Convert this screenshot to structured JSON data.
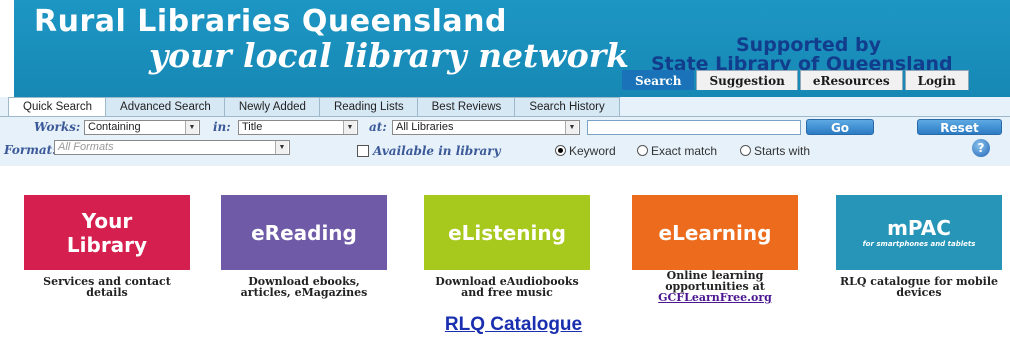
{
  "header": {
    "title_line1": "Rural Libraries Queensland",
    "title_line2": "your local library network",
    "supported_line1": "Supported by",
    "supported_line2": "State Library of Queensland",
    "tabs": [
      "Search",
      "Suggestion",
      "eResources",
      "Login"
    ],
    "active_tab": "Search"
  },
  "search": {
    "tabs": [
      "Quick Search",
      "Advanced Search",
      "Newly Added",
      "Reading Lists",
      "Best Reviews",
      "Search History"
    ],
    "active_tab": "Quick Search",
    "works_label": "Works:",
    "works_value": "Containing",
    "in_label": "in:",
    "in_value": "Title",
    "at_label": "at:",
    "at_value": "All Libraries",
    "query_value": "",
    "go_label": "Go",
    "reset_label": "Reset",
    "format_label": "Format:",
    "format_placeholder": "All Formats",
    "available_label": "Available in library",
    "available_checked": false,
    "match_options": [
      "Keyword",
      "Exact match",
      "Starts with"
    ],
    "match_selected": "Keyword",
    "help_icon": "question-mark-icon"
  },
  "tiles": [
    {
      "title_line1": "Your",
      "title_line2": "Library",
      "caption_line1": "Services and contact",
      "caption_line2": "details",
      "color": "#d51f4f"
    },
    {
      "title_line1": "eReading",
      "caption_line1": "Download ebooks,",
      "caption_line2": "articles, eMagazines",
      "color": "#6f5aa8"
    },
    {
      "title_line1": "eListening",
      "caption_line1": "Download eAudiobooks",
      "caption_line2": "and free music",
      "color": "#a7c81c"
    },
    {
      "title_line1": "eLearning",
      "caption_line1": "Online learning",
      "caption_line2": "opportunities at",
      "caption_link": "GCFLearnFree.org",
      "color": "#ec6b1d"
    },
    {
      "title_line1": "mPAC",
      "title_sub": "for smartphones and tablets",
      "caption_line1": "RLQ catalogue for mobile",
      "caption_line2": "devices",
      "color": "#2695b8"
    }
  ],
  "footer_link": "RLQ Catalogue"
}
